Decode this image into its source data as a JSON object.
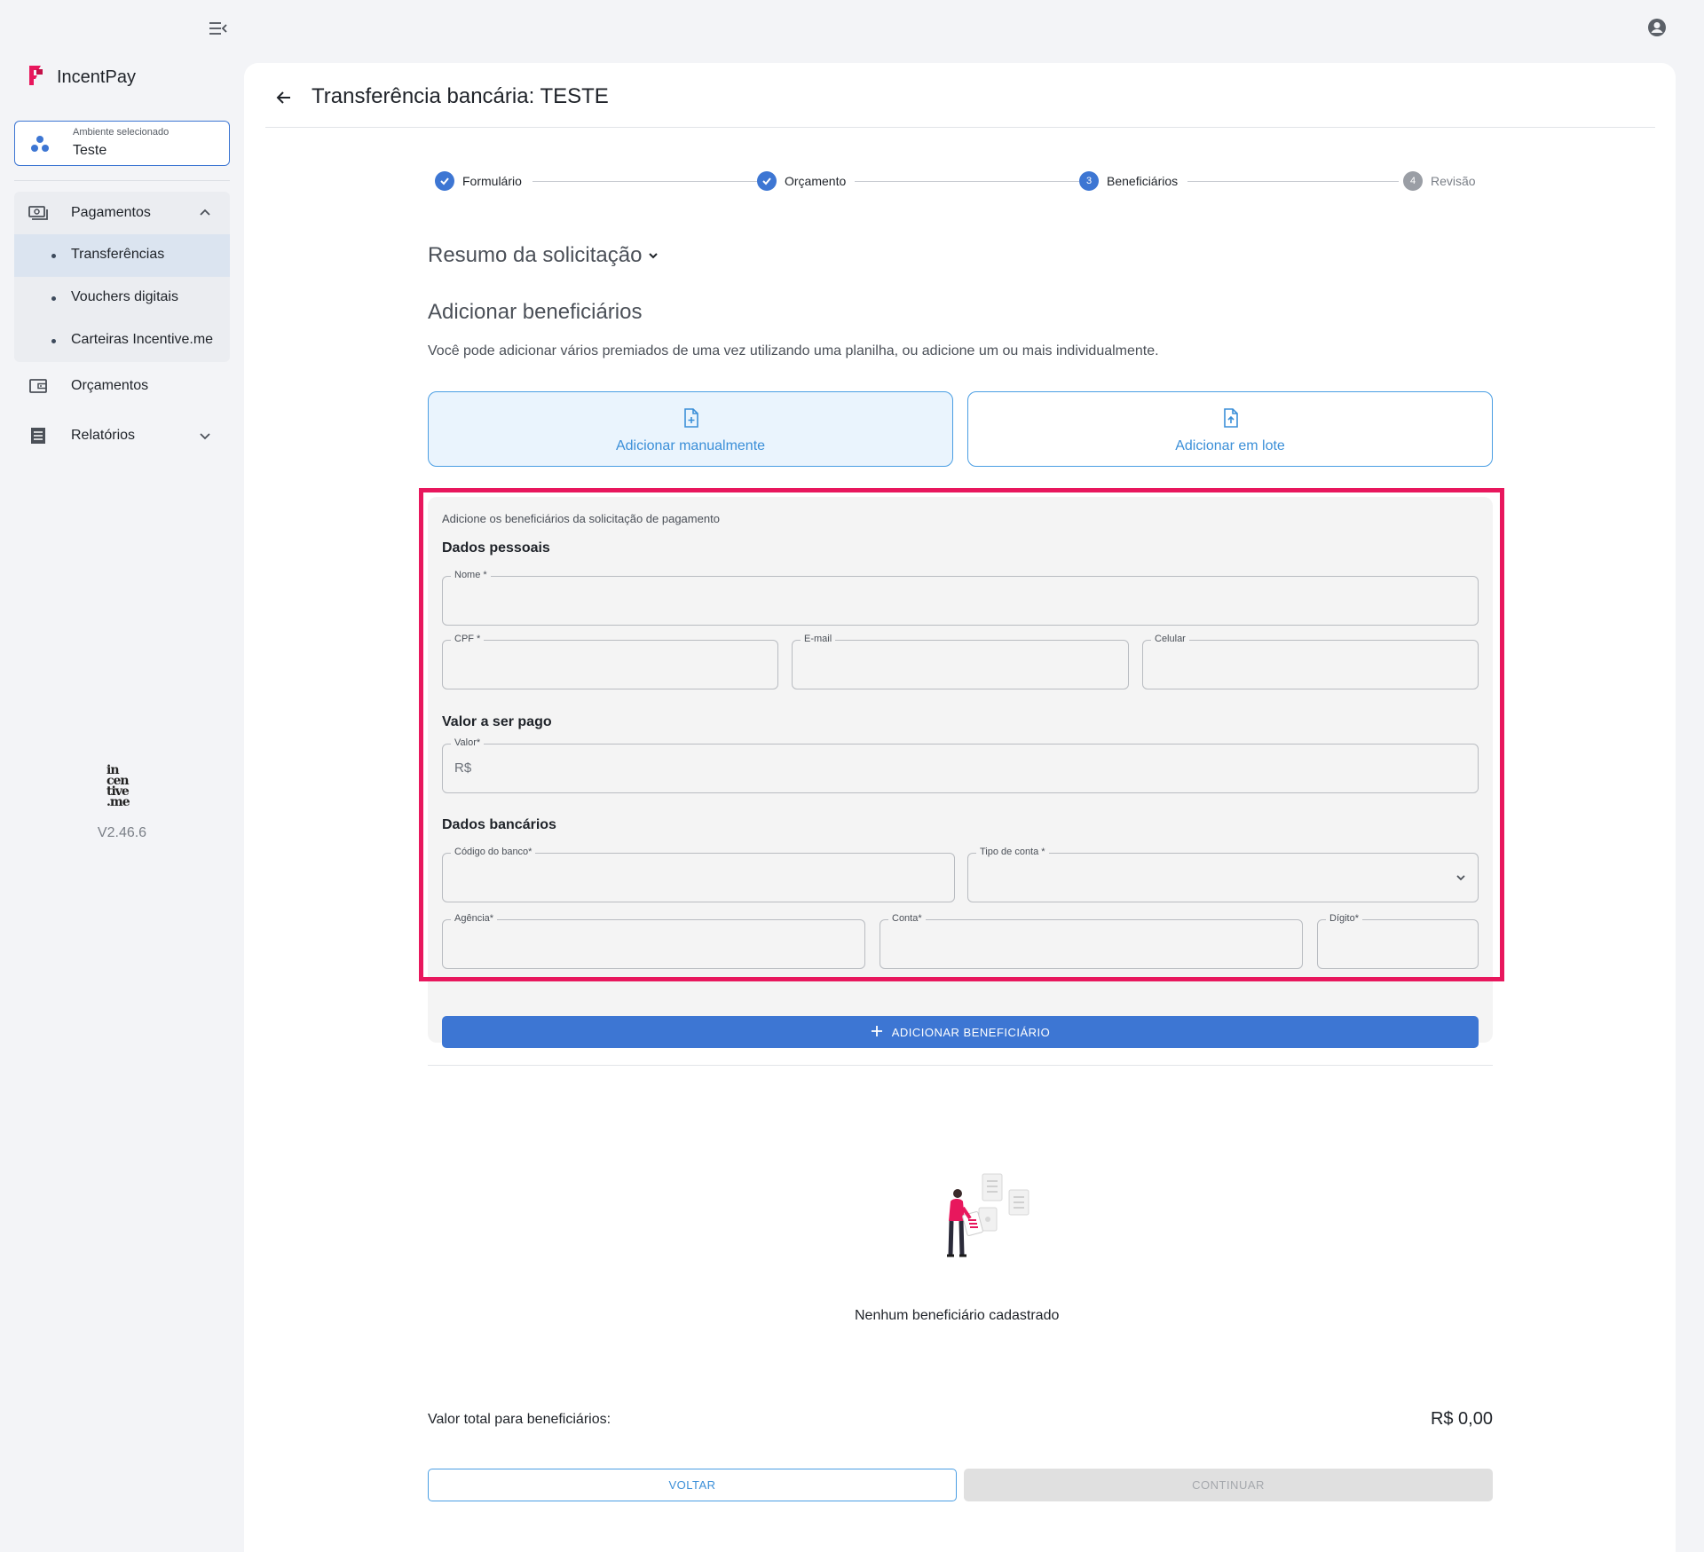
{
  "sidebar": {
    "brand": "IncentPay",
    "environment": {
      "label": "Ambiente selecionado",
      "value": "Teste"
    },
    "nav": {
      "payments": "Pagamentos",
      "sub": [
        "Transferências",
        "Vouchers digitais",
        "Carteiras Incentive.me"
      ],
      "budgets": "Orçamentos",
      "reports": "Relatórios"
    },
    "logo_lines": [
      "in",
      "cen",
      "tive",
      ".me"
    ],
    "version": "V2.46.6"
  },
  "header": {
    "title": "Transferência bancária: TESTE"
  },
  "stepper": {
    "steps": [
      {
        "number": "1",
        "label": "Formulário",
        "state": "done"
      },
      {
        "number": "2",
        "label": "Orçamento",
        "state": "done"
      },
      {
        "number": "3",
        "label": "Beneficiários",
        "state": "current"
      },
      {
        "number": "4",
        "label": "Revisão",
        "state": "todo"
      }
    ]
  },
  "summary_toggle": "Resumo da solicitação",
  "section": {
    "title": "Adicionar beneficiários",
    "description": "Você pode adicionar vários premiados de uma vez utilizando uma planilha, ou adicione um ou mais individualmente."
  },
  "modes": {
    "manual": "Adicionar manualmente",
    "batch": "Adicionar em lote"
  },
  "form": {
    "caption": "Adicione os beneficiários da solicitação de pagamento",
    "personal_heading": "Dados pessoais",
    "name_label": "Nome *",
    "cpf_label": "CPF *",
    "email_label": "E-mail",
    "phone_label": "Celular",
    "amount_heading": "Valor a ser pago",
    "amount_label": "Valor*",
    "amount_prefix": "R$",
    "bank_heading": "Dados bancários",
    "bank_code_label": "Código do banco*",
    "account_type_label": "Tipo de conta *",
    "agency_label": "Agência*",
    "account_label": "Conta*",
    "digit_label": "Dígito*",
    "add_button": "ADICIONAR BENEFICIÁRIO"
  },
  "empty_state": "Nenhum beneficiário cadastrado",
  "totals": {
    "label": "Valor total para beneficiários:",
    "value": "R$ 0,00"
  },
  "actions": {
    "back": "VOLTAR",
    "continue": "CONTINUAR"
  },
  "colors": {
    "primary": "#3d76d3",
    "accent_link": "#3b8fd8",
    "highlight": "#e8175d",
    "brand": "#e8175d"
  }
}
